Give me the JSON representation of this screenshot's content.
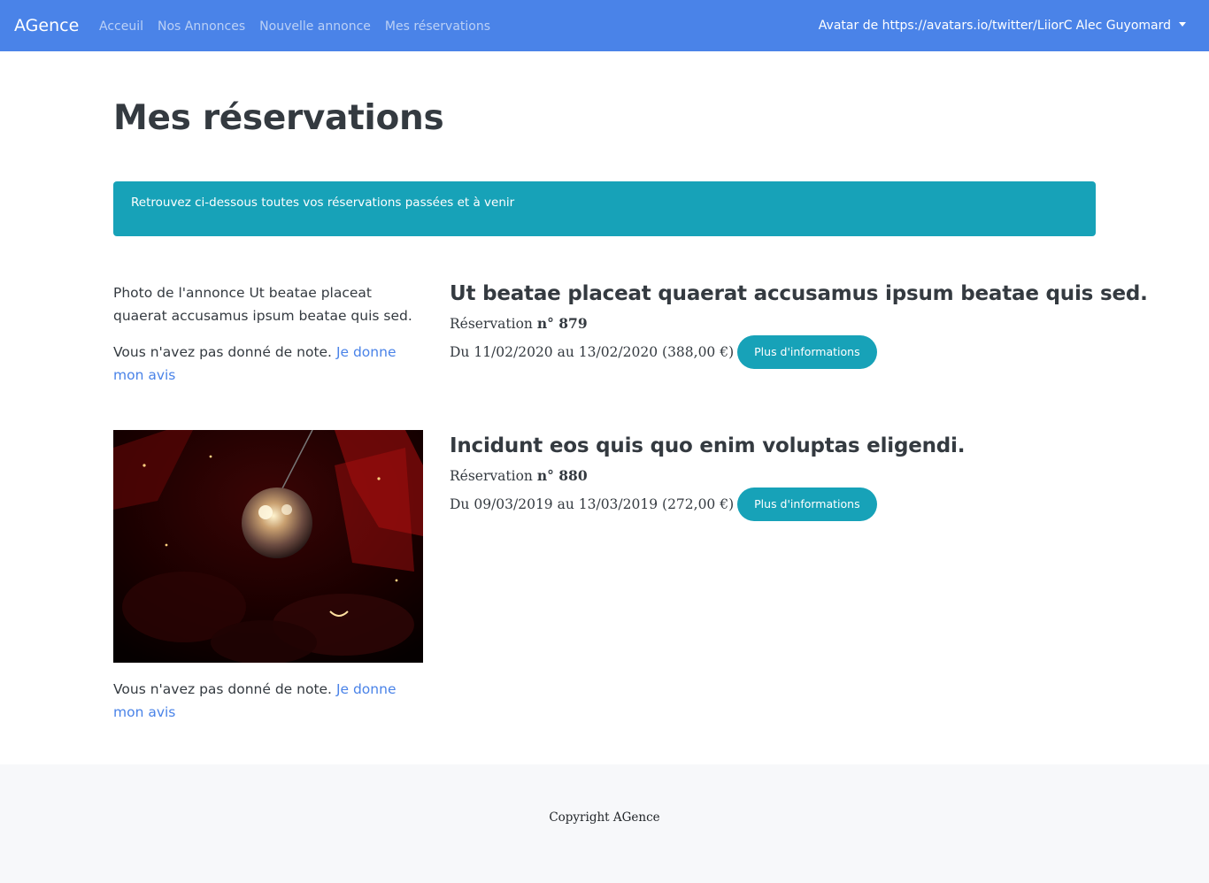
{
  "navbar": {
    "brand": "AGence",
    "links": [
      "Acceuil",
      "Nos Annonces",
      "Nouvelle annonce",
      "Mes réservations"
    ],
    "avatar_alt": "Avatar de https://avatars.io/twitter/LiiorC",
    "user_name": "Alec Guyomard",
    "colors": {
      "background": "#4a83e8"
    }
  },
  "page": {
    "title": "Mes réservations",
    "alert": "Retrouvez ci-dessous toutes vos réservations passées et à venir"
  },
  "reservations": [
    {
      "photo_alt": "Photo de l'annonce Ut beatae placeat quaerat accusamus ipsum beatae quis sed.",
      "note_text": "Vous n'avez pas donné de note.",
      "note_link": "Je donne mon avis",
      "title": "Ut beatae placeat quaerat accusamus ipsum beatae quis sed.",
      "number_label": "Réservation",
      "number": "n° 879",
      "dates": "Du 11/02/2020 au 13/02/2020 (388,00 €)",
      "button": "Plus d'informations"
    },
    {
      "photo_alt": "",
      "note_text": "Vous n'avez pas donné de note.",
      "note_link": "Je donne mon avis",
      "title": "Incidunt eos quis quo enim voluptas eligendi.",
      "number_label": "Réservation",
      "number": "n° 880",
      "dates": "Du 09/03/2019 au 13/03/2019 (272,00 €)",
      "button": "Plus d'informations"
    }
  ],
  "footer": {
    "copyright": "Copyright AGence"
  },
  "colors": {
    "info": "#17a2b8",
    "link": "#4a83e8",
    "text": "#343a40",
    "footer_bg": "#f7f8fa"
  }
}
